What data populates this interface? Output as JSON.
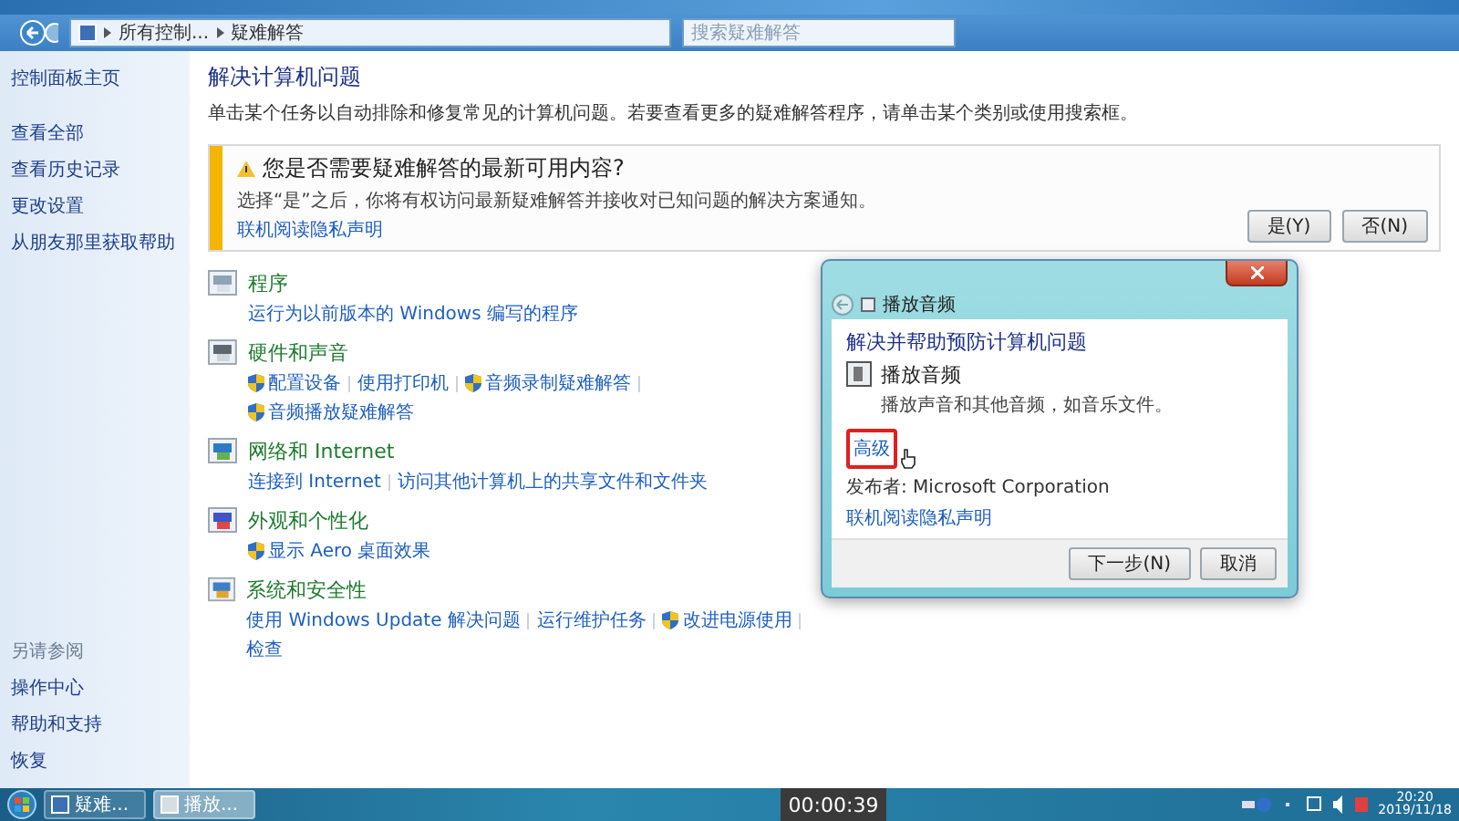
{
  "window": {
    "breadcrumb": [
      "所有控制...",
      "疑难解答"
    ],
    "search": {
      "placeholder": "搜索疑难解答"
    }
  },
  "sidebar": {
    "items": [
      "控制面板主页",
      "查看全部",
      "查看历史记录",
      "更改设置",
      "从朋友那里获取帮助"
    ],
    "see_also_heading": "另请参阅",
    "see_also": [
      "操作中心",
      "帮助和支持",
      "恢复"
    ]
  },
  "main": {
    "title": "解决计算机问题",
    "description": "单击某个任务以自动排除和修复常见的计算机问题。若要查看更多的疑难解答程序，请单击某个类别或使用搜索框。"
  },
  "banner": {
    "title": "您是否需要疑难解答的最新可用内容?",
    "text": "选择“是”之后，你将有权访问最新疑难解答并接收对已知问题的解决方案通知。",
    "link": "联机阅读隐私声明",
    "buttons": [
      "是(Y)",
      "否(N)"
    ]
  },
  "categories": [
    {
      "kind": "programs",
      "title": "程序",
      "links": [
        {
          "label": "运行为以前版本的 Windows 编写的程序",
          "shield": false
        }
      ]
    },
    {
      "kind": "hardware",
      "title": "硬件和声音",
      "links": [
        {
          "label": "配置设备",
          "shield": true
        },
        {
          "label": "使用打印机",
          "shield": false
        },
        {
          "label": "音频录制疑难解答",
          "shield": true
        },
        {
          "label": "音频播放疑难解答",
          "shield": true
        }
      ]
    },
    {
      "kind": "network",
      "title": "网络和 Internet",
      "links": [
        {
          "label": "连接到 Internet",
          "shield": false
        },
        {
          "label": "访问其他计算机上的共享文件和文件夹",
          "shield": false
        }
      ]
    },
    {
      "kind": "appearance",
      "title": "外观和个性化",
      "links": [
        {
          "label": "显示 Aero 桌面效果",
          "shield": true
        }
      ]
    },
    {
      "kind": "security",
      "title": "系统和安全性",
      "links": [
        {
          "label": "使用 Windows Update 解决问题",
          "shield": false
        },
        {
          "label": "运行维护任务",
          "shield": false
        },
        {
          "label": "改进电源使用",
          "shield": true
        },
        {
          "label": "检查",
          "shield": false
        }
      ]
    }
  ],
  "dialog": {
    "title": "播放音频",
    "heading": "解决并帮助预防计算机问题",
    "item": {
      "title": "播放音频",
      "description": "播放声音和其他音频，如音乐文件。"
    },
    "advanced_link": "高级",
    "advanced_highlighted": true,
    "publisher": "发布者: Microsoft Corporation",
    "privacy_link": "联机阅读隐私声明",
    "buttons": [
      "下一步(N)",
      "取消"
    ]
  },
  "taskbar": {
    "items": [
      {
        "label": "疑难...",
        "selected": false
      },
      {
        "label": "播放...",
        "selected": true
      }
    ],
    "time": "20:20",
    "date": "2019/11/18"
  },
  "recording_timer": "00:00:39"
}
